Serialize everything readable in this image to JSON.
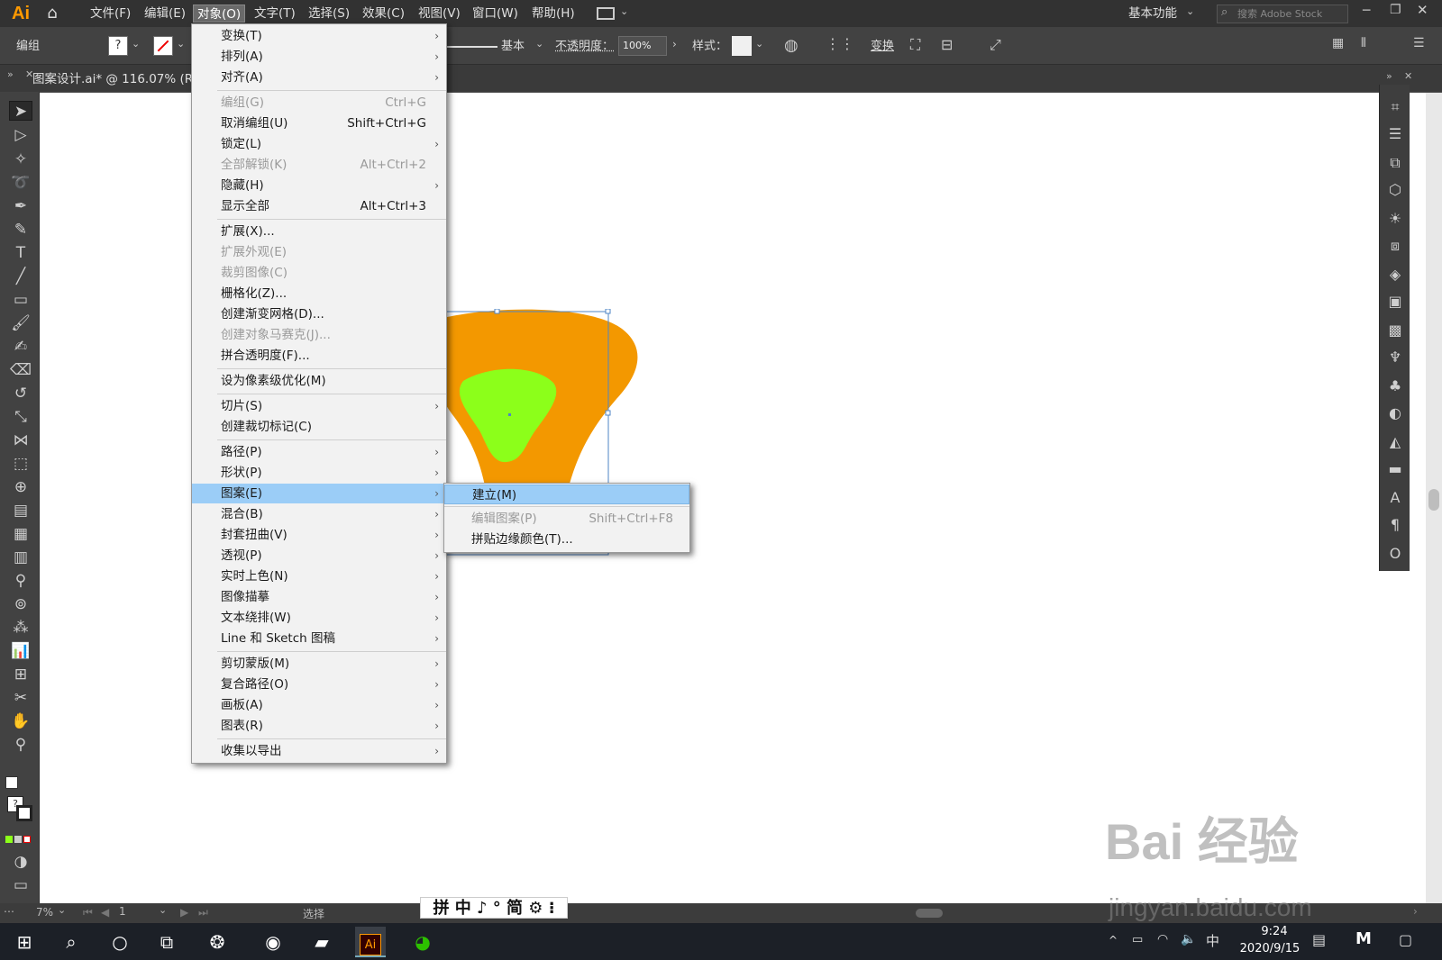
{
  "app": {
    "logo": "Ai"
  },
  "menubar": {
    "items": [
      "文件(F)",
      "编辑(E)",
      "对象(O)",
      "文字(T)",
      "选择(S)",
      "效果(C)",
      "视图(V)",
      "窗口(W)",
      "帮助(H)"
    ],
    "workspace": "基本功能",
    "search_placeholder": "搜索 Adobe Stock"
  },
  "control_bar": {
    "group_label": "编组",
    "stroke_style": "基本",
    "opacity_label": "不透明度：",
    "opacity_value": "100%",
    "style_label": "样式：",
    "transform_label": "变换"
  },
  "document": {
    "tab_title": "图案设计.ai* @ 116.07% (R"
  },
  "object_menu": {
    "items": [
      {
        "label": "变换(T)",
        "shortcut": "",
        "submenu": true,
        "disabled": false
      },
      {
        "label": "排列(A)",
        "shortcut": "",
        "submenu": true,
        "disabled": false
      },
      {
        "label": "对齐(A)",
        "shortcut": "",
        "submenu": true,
        "disabled": false
      },
      {
        "label": "编组(G)",
        "shortcut": "Ctrl+G",
        "submenu": false,
        "disabled": true
      },
      {
        "label": "取消编组(U)",
        "shortcut": "Shift+Ctrl+G",
        "submenu": false,
        "disabled": false
      },
      {
        "label": "锁定(L)",
        "shortcut": "",
        "submenu": true,
        "disabled": false
      },
      {
        "label": "全部解锁(K)",
        "shortcut": "Alt+Ctrl+2",
        "submenu": false,
        "disabled": true
      },
      {
        "label": "隐藏(H)",
        "shortcut": "",
        "submenu": true,
        "disabled": false
      },
      {
        "label": "显示全部",
        "shortcut": "Alt+Ctrl+3",
        "submenu": false,
        "disabled": false
      },
      {
        "label": "扩展(X)...",
        "shortcut": "",
        "submenu": false,
        "disabled": false
      },
      {
        "label": "扩展外观(E)",
        "shortcut": "",
        "submenu": false,
        "disabled": true
      },
      {
        "label": "裁剪图像(C)",
        "shortcut": "",
        "submenu": false,
        "disabled": true
      },
      {
        "label": "栅格化(Z)...",
        "shortcut": "",
        "submenu": false,
        "disabled": false
      },
      {
        "label": "创建渐变网格(D)...",
        "shortcut": "",
        "submenu": false,
        "disabled": false
      },
      {
        "label": "创建对象马赛克(J)...",
        "shortcut": "",
        "submenu": false,
        "disabled": true
      },
      {
        "label": "拼合透明度(F)...",
        "shortcut": "",
        "submenu": false,
        "disabled": false
      },
      {
        "label": "设为像素级优化(M)",
        "shortcut": "",
        "submenu": false,
        "disabled": false
      },
      {
        "label": "切片(S)",
        "shortcut": "",
        "submenu": true,
        "disabled": false
      },
      {
        "label": "创建裁切标记(C)",
        "shortcut": "",
        "submenu": false,
        "disabled": false
      },
      {
        "label": "路径(P)",
        "shortcut": "",
        "submenu": true,
        "disabled": false
      },
      {
        "label": "形状(P)",
        "shortcut": "",
        "submenu": true,
        "disabled": false
      },
      {
        "label": "图案(E)",
        "shortcut": "",
        "submenu": true,
        "disabled": false
      },
      {
        "label": "混合(B)",
        "shortcut": "",
        "submenu": true,
        "disabled": false
      },
      {
        "label": "封套扭曲(V)",
        "shortcut": "",
        "submenu": true,
        "disabled": false
      },
      {
        "label": "透视(P)",
        "shortcut": "",
        "submenu": true,
        "disabled": false
      },
      {
        "label": "实时上色(N)",
        "shortcut": "",
        "submenu": true,
        "disabled": false
      },
      {
        "label": "图像描摹",
        "shortcut": "",
        "submenu": true,
        "disabled": false
      },
      {
        "label": "文本绕排(W)",
        "shortcut": "",
        "submenu": true,
        "disabled": false
      },
      {
        "label": "Line 和 Sketch 图稿",
        "shortcut": "",
        "submenu": true,
        "disabled": false
      },
      {
        "label": "剪切蒙版(M)",
        "shortcut": "",
        "submenu": true,
        "disabled": false
      },
      {
        "label": "复合路径(O)",
        "shortcut": "",
        "submenu": true,
        "disabled": false
      },
      {
        "label": "画板(A)",
        "shortcut": "",
        "submenu": true,
        "disabled": false
      },
      {
        "label": "图表(R)",
        "shortcut": "",
        "submenu": true,
        "disabled": false
      },
      {
        "label": "收集以导出",
        "shortcut": "",
        "submenu": true,
        "disabled": false
      }
    ],
    "highlighted": "图案(E)"
  },
  "pattern_submenu": {
    "items": [
      {
        "label": "建立(M)",
        "shortcut": "",
        "disabled": false
      },
      {
        "label": "编辑图案(P)",
        "shortcut": "Shift+Ctrl+F8",
        "disabled": true
      },
      {
        "label": "拼贴边缘颜色(T)...",
        "shortcut": "",
        "disabled": false
      }
    ],
    "highlighted": "建立(M)"
  },
  "status_bar": {
    "zoom": "7%",
    "artboard": "1",
    "tool": "选择"
  },
  "ime_bar": {
    "text": "拼 中 ♪ ° 简 ⚙ ⁝"
  },
  "taskbar": {
    "time": "9:24",
    "date": "2020/9/15",
    "ime": "中"
  },
  "watermark": {
    "line1": "Bai 经验",
    "line2": "jingyan.baidu.com"
  },
  "colors": {
    "orange": "#f39800",
    "green": "#8cff1a",
    "menu_highlight": "#9bcdf7",
    "ai_orange": "#ff9a00"
  }
}
